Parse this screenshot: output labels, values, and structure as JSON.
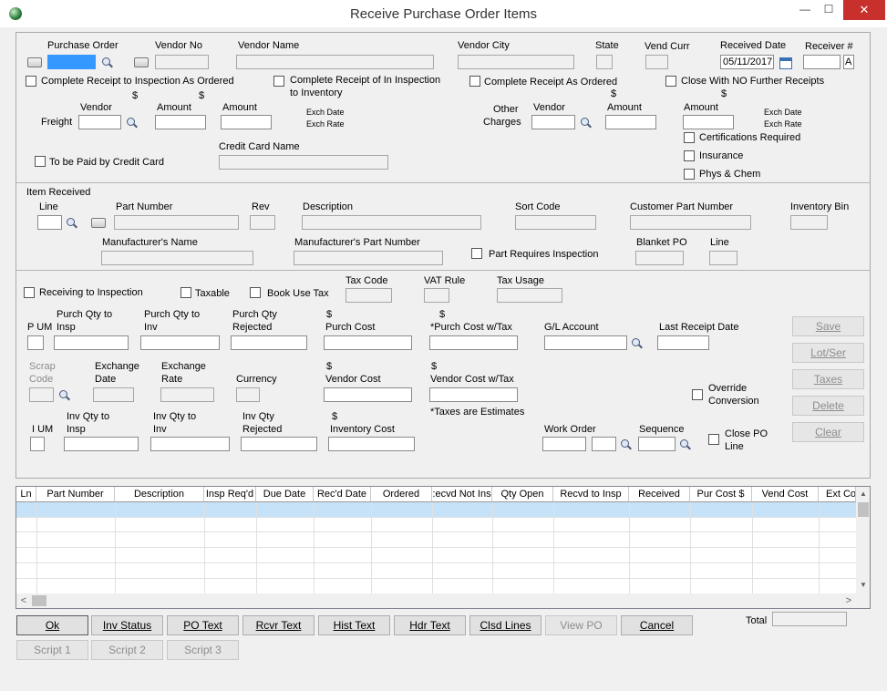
{
  "window": {
    "title": "Receive Purchase Order Items",
    "minimize_glyph": "—",
    "maximize_glyph": "☐",
    "close_glyph": "✕"
  },
  "header": {
    "purchase_order_label": "Purchase Order",
    "vendor_no_label": "Vendor No",
    "vendor_name_label": "Vendor Name",
    "vendor_city_label": "Vendor City",
    "state_label": "State",
    "vend_curr_label": "Vend Curr",
    "received_date_label": "Received Date",
    "received_date_value": "05/11/2017",
    "receiver_label": "Receiver #",
    "receiver_suffix": "A",
    "complete_receipt_inspection": "Complete Receipt to Inspection As Ordered",
    "complete_receipt_in_inspection_line1": "Complete Receipt of In Inspection",
    "complete_receipt_in_inspection_line2": "to Inventory",
    "complete_receipt_as_ordered": "Complete Receipt As Ordered",
    "close_no_further": "Close With NO Further Receipts",
    "freight_label": "Freight",
    "freight_vendor_label": "Vendor",
    "freight_amount_label": "Amount",
    "freight_amount2_label": "Amount",
    "currency_symbol": "$",
    "exch_date_label": "Exch Date",
    "exch_rate_label": "Exch Rate",
    "other_label": "Other",
    "charges_label": "Charges",
    "other_vendor_label": "Vendor",
    "other_amount_label": "Amount",
    "other_amount2_label": "Amount",
    "certifications_required": "Certifications Required",
    "insurance": "Insurance",
    "phys_chem": "Phys & Chem",
    "paid_by_credit_card": "To be Paid by Credit Card",
    "credit_card_name_label": "Credit Card Name"
  },
  "item": {
    "item_received_label": "Item Received",
    "line_label": "Line",
    "part_number_label": "Part Number",
    "rev_label": "Rev",
    "description_label": "Description",
    "sort_code_label": "Sort Code",
    "customer_part_number_label": "Customer Part Number",
    "inventory_bin_label": "Inventory Bin",
    "manufacturer_name_label": "Manufacturer's Name",
    "manufacturer_part_label": "Manufacturer's Part Number",
    "part_requires_inspection": "Part Requires Inspection",
    "blanket_po_label": "Blanket PO",
    "blanket_line_label": "Line"
  },
  "receiving": {
    "receiving_to_inspection": "Receiving to Inspection",
    "taxable": "Taxable",
    "book_use_tax": "Book Use Tax",
    "tax_code_label": "Tax Code",
    "vat_rule_label": "VAT Rule",
    "tax_usage_label": "Tax Usage",
    "p_um_label": "P UM",
    "purch_qty_insp_label1": "Purch Qty to",
    "purch_qty_insp_label2": "Insp",
    "purch_qty_inv_label1": "Purch Qty to",
    "purch_qty_inv_label2": "Inv",
    "purch_qty_rej_label1": "Purch Qty",
    "purch_qty_rej_label2": "Rejected",
    "purch_cost_label": "Purch Cost",
    "purch_cost_tax_label": "*Purch Cost w/Tax",
    "gl_account_label": "G/L Account",
    "last_receipt_date_label": "Last Receipt Date",
    "scrap_code_label1": "Scrap",
    "scrap_code_label2": "Code",
    "exchange_date_label1": "Exchange",
    "exchange_date_label2": "Date",
    "exchange_rate_label1": "Exchange",
    "exchange_rate_label2": "Rate",
    "currency_label": "Currency",
    "vendor_cost_label": "Vendor Cost",
    "vendor_cost_tax_label": "Vendor Cost w/Tax",
    "override_conversion_line1": "Override",
    "override_conversion_line2": "Conversion",
    "i_um_label": "I UM",
    "inv_qty_insp_label1": "Inv Qty to",
    "inv_qty_insp_label2": "Insp",
    "inv_qty_inv_label1": "Inv Qty to",
    "inv_qty_inv_label2": "Inv",
    "inv_qty_rej_label1": "Inv Qty",
    "inv_qty_rej_label2": "Rejected",
    "inventory_cost_label": "Inventory Cost",
    "taxes_estimates": "*Taxes are Estimates",
    "work_order_label": "Work Order",
    "sequence_label": "Sequence",
    "close_po_line1": "Close PO",
    "close_po_line2": "Line",
    "save": "Save",
    "lot_ser": "Lot/Ser",
    "taxes": "Taxes",
    "delete": "Delete",
    "clear": "Clear"
  },
  "grid": {
    "columns": [
      "Ln",
      "Part Number",
      "Description",
      "Insp Req'd",
      "Due Date",
      "Rec'd Date",
      "Ordered",
      ":ecvd Not Ins",
      "Qty Open",
      "Recvd to Insp",
      "Received",
      "Pur Cost $",
      "Vend Cost",
      "Ext Co"
    ],
    "scroll_up": "▲",
    "scroll_down": "▼",
    "scroll_left": "<",
    "scroll_right": ">"
  },
  "footer": {
    "ok": "Ok",
    "inv_status": "Inv Status",
    "po_text": "PO Text",
    "rcvr_text": "Rcvr Text",
    "hist_text": "Hist Text",
    "hdr_text": "Hdr Text",
    "clsd_lines": "Clsd Lines",
    "view_po": "View PO",
    "cancel": "Cancel",
    "total_label": "Total",
    "script1": "Script 1",
    "script2": "Script 2",
    "script3": "Script 3"
  }
}
